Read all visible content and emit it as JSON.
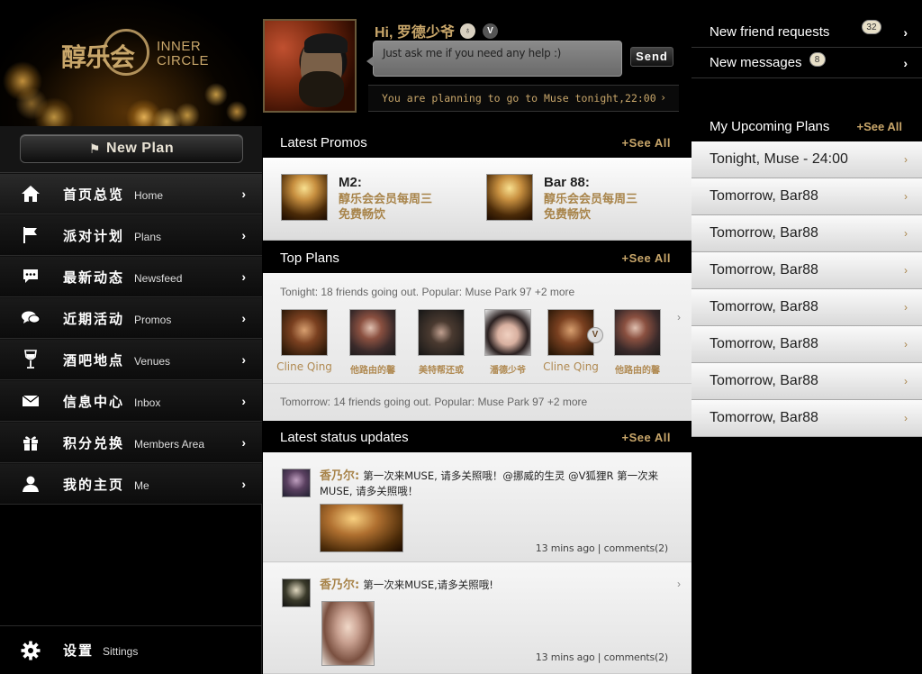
{
  "sidebar": {
    "logo": {
      "cn": "醇乐会",
      "en_line1": "INNER",
      "en_line2": "CIRCLE"
    },
    "new_plan_label": "New Plan",
    "nav": [
      {
        "cn": "首页总览",
        "en": "Home",
        "icon": "home-icon"
      },
      {
        "cn": "派对计划",
        "en": "Plans",
        "icon": "flag-icon"
      },
      {
        "cn": "最新动态",
        "en": "Newsfeed",
        "icon": "speech-bubble-icon"
      },
      {
        "cn": "近期活动",
        "en": "Promos",
        "icon": "chat-bubbles-icon"
      },
      {
        "cn": "酒吧地点",
        "en": "Venues",
        "icon": "wine-glass-icon"
      },
      {
        "cn": "信息中心",
        "en": "Inbox",
        "icon": "envelope-icon"
      },
      {
        "cn": "积分兑换",
        "en": "Members Area",
        "icon": "gift-icon"
      },
      {
        "cn": "我的主页",
        "en": "Me",
        "icon": "person-icon"
      }
    ],
    "settings": {
      "cn": "设置",
      "en": "Sittings",
      "icon": "gear-icon"
    }
  },
  "profile": {
    "greeting": "Hi, 罗德少爷",
    "ask_placeholder": "Just ask me if you need any help :)",
    "send_label": "Send",
    "plan_notice": "You are planning to go to Muse tonight,22:00"
  },
  "promos": {
    "title": "Latest Promos",
    "see_all": "+See All",
    "items": [
      {
        "title": "M2:",
        "line1": "醇乐会会员每周三",
        "line2": "免费畅饮"
      },
      {
        "title": "Bar 88:",
        "line1": "醇乐会会员每周三",
        "line2": "免费畅饮"
      }
    ]
  },
  "top_plans": {
    "title": "Top Plans",
    "see_all": "+See All",
    "tonight": "Tonight: 18 friends going out. Popular: Muse Park 97 +2 more",
    "tomorrow": "Tomorrow: 14 friends going out. Popular: Muse Park 97 +2 more",
    "friends": [
      {
        "name": "Cline Qing"
      },
      {
        "name": "他路由的馨"
      },
      {
        "name": "美特帮还或"
      },
      {
        "name": "潘德少爷"
      },
      {
        "name": "Cline Qing",
        "badge": "V"
      },
      {
        "name": "他路由的馨"
      }
    ]
  },
  "status": {
    "title": "Latest status updates",
    "see_all": "+See All",
    "items": [
      {
        "name": "香乃尔:",
        "text": "第一次来MUSE, 请多关照哦！@挪威的生灵 @V狐狸R 第一次来MUSE, 请多关照哦！",
        "meta": "13 mins ago | comments(2)"
      },
      {
        "name": "香乃尔:",
        "text": "第一次来MUSE,请多关照哦!",
        "meta": "13 mins ago | comments(2)"
      }
    ]
  },
  "right": {
    "friend_requests": {
      "label": "New friend requests",
      "count": "32"
    },
    "messages": {
      "label": "New messages",
      "count": "8"
    },
    "upcoming_title": "My Upcoming Plans",
    "upcoming_see_all": "+See All",
    "upcoming": [
      "Tonight, Muse - 24:00",
      "Tomorrow, Bar88",
      "Tomorrow, Bar88",
      "Tomorrow, Bar88",
      "Tomorrow, Bar88",
      "Tomorrow, Bar88",
      "Tomorrow, Bar88",
      "Tomorrow, Bar88"
    ]
  },
  "colors": {
    "gold": "#c8a66a",
    "background": "#000000",
    "panel": "#eeeeee"
  }
}
